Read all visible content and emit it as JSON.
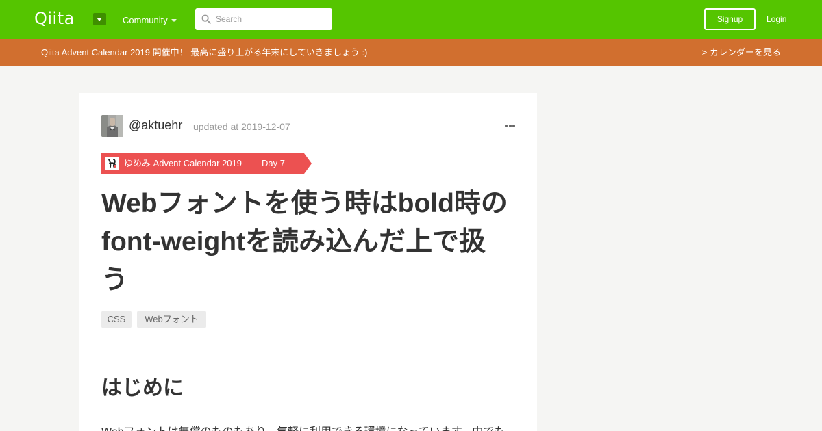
{
  "header": {
    "logo": "Qiita",
    "community_label": "Community",
    "search_placeholder": "Search",
    "signup_label": "Signup",
    "login_label": "Login",
    "bg_color": "#55c500"
  },
  "banner": {
    "text": "Qiita Advent Calendar 2019 開催中！ 最高に盛り上がる年末にしていきましょう :)",
    "link": "> カレンダーを見る",
    "bg_color": "#d16f2f"
  },
  "article": {
    "author": "@aktuehr",
    "updated": "updated at 2019-12-07",
    "calendar": {
      "title": "ゆめみ Advent Calendar 2019",
      "day": "Day 7",
      "color": "#ec5151"
    },
    "title": "Webフォントを使う時はbold時のfont-weightを読み込んだ上で扱う",
    "tags": [
      "CSS",
      "Webフォント"
    ],
    "section_heading": "はじめに",
    "body_first_line": "Webフォントは無償のものもあり、気軽に利用できる環境になっています。中でも"
  }
}
